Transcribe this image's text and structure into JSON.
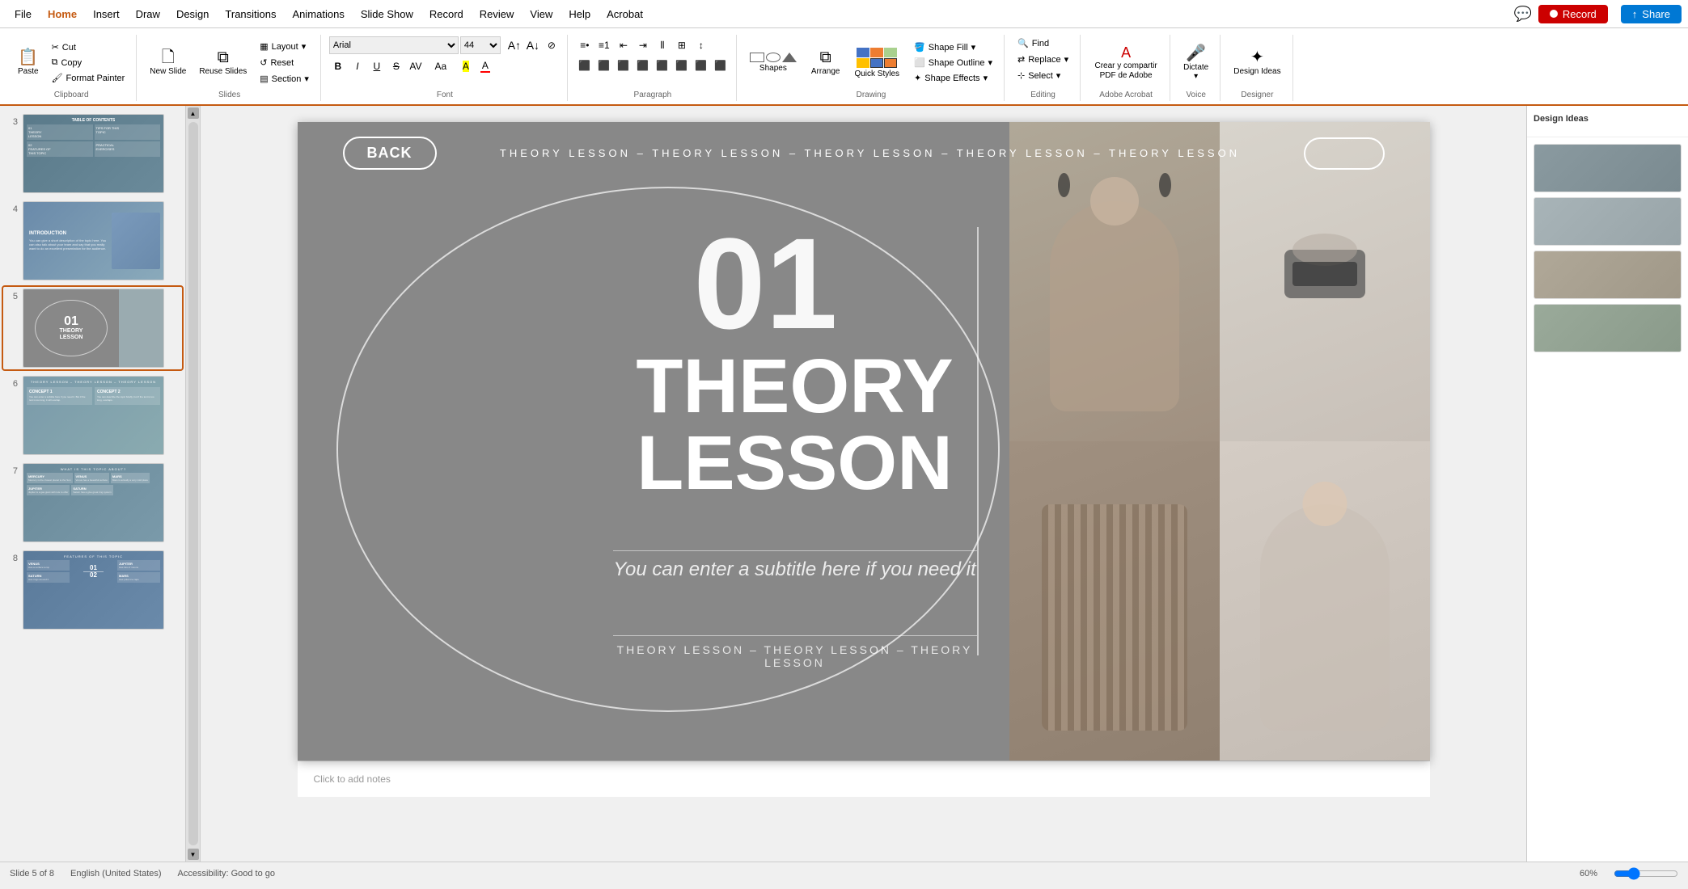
{
  "app": {
    "title": "PowerPoint",
    "record_btn": "Record",
    "share_btn": "Share"
  },
  "menu": {
    "items": [
      "File",
      "Home",
      "Insert",
      "Draw",
      "Design",
      "Transitions",
      "Animations",
      "Slide Show",
      "Record",
      "Review",
      "View",
      "Help",
      "Acrobat"
    ]
  },
  "ribbon": {
    "active_tab": "Home",
    "groups": {
      "clipboard": {
        "label": "Clipboard",
        "paste_label": "Paste",
        "cut_label": "Cut",
        "copy_label": "Copy",
        "format_painter_label": "Format Painter"
      },
      "slides": {
        "label": "Slides",
        "new_slide_label": "New Slide",
        "reuse_slides_label": "Reuse Slides",
        "layout_label": "Layout",
        "reset_label": "Reset",
        "section_label": "Section"
      },
      "font": {
        "label": "Font",
        "font_name": "Arial",
        "font_size": "44",
        "bold": "B",
        "italic": "I",
        "underline": "U",
        "strikethrough": "S",
        "spacing_label": "AV",
        "change_case_label": "Aa",
        "font_color_label": "A",
        "highlight_label": "A"
      },
      "paragraph": {
        "label": "Paragraph"
      },
      "drawing": {
        "label": "Drawing",
        "shapes_label": "Shapes",
        "arrange_label": "Arrange",
        "quick_styles_label": "Quick Styles",
        "shape_fill_label": "Shape Fill",
        "shape_outline_label": "Shape Outline",
        "shape_effects_label": "Shape Effects"
      },
      "editing": {
        "label": "Editing",
        "find_label": "Find",
        "replace_label": "Replace",
        "select_label": "Select"
      },
      "adobe": {
        "label": "Adobe Acrobat",
        "create_label": "Crear y compartir PDF de Adobe"
      },
      "voice": {
        "label": "Voice",
        "dictate_label": "Dictate"
      },
      "designer": {
        "label": "Designer",
        "design_ideas_label": "Design Ideas"
      }
    }
  },
  "slides": [
    {
      "num": "3",
      "type": "table-of-contents"
    },
    {
      "num": "4",
      "type": "introduction"
    },
    {
      "num": "5",
      "type": "theory-lesson",
      "active": true
    },
    {
      "num": "6",
      "type": "concept"
    },
    {
      "num": "7",
      "type": "what-is-topic"
    },
    {
      "num": "8",
      "type": "features"
    }
  ],
  "slide": {
    "back_label": "BACK",
    "top_title": "THEORY LESSON – THEORY LESSON – THEORY LESSON – THEORY LESSON – THEORY LESSON",
    "number": "01",
    "title_line1": "THEORY",
    "title_line2": "LESSON",
    "subtitle": "You can enter a subtitle here if you need it",
    "bottom_text": "THEORY LESSON – THEORY LESSON – THEORY LESSON"
  },
  "notes": {
    "placeholder": "Click to add notes"
  },
  "status": {
    "slide_count": "Slide 5 of 8",
    "language": "English (United States)",
    "accessibility": "Accessibility: Good to go",
    "zoom": "60%"
  },
  "right_panel": {
    "title": "Design Ideas"
  }
}
